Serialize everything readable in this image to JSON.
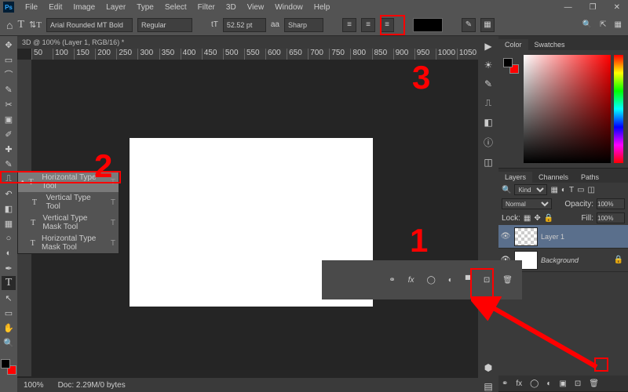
{
  "menu": {
    "items": [
      "File",
      "Edit",
      "Image",
      "Layer",
      "Type",
      "Select",
      "Filter",
      "3D",
      "View",
      "Window",
      "Help"
    ]
  },
  "optbar": {
    "font": "Arial Rounded MT Bold",
    "style": "Regular",
    "size": "52.52 pt",
    "aa": "Sharp",
    "size_prefix": "tT",
    "aa_prefix": "aa"
  },
  "tab": {
    "title": "3D @ 100% (Layer 1, RGB/16) *"
  },
  "ruler": [
    "50",
    "100",
    "150",
    "200",
    "250",
    "300",
    "350",
    "400",
    "450",
    "500",
    "550",
    "600",
    "650",
    "700",
    "750",
    "800",
    "850",
    "900",
    "950",
    "1000",
    "1050"
  ],
  "status": {
    "zoom": "100%",
    "doc": "Doc: 2.29M/0 bytes"
  },
  "flyout": {
    "items": [
      {
        "glyph": "T",
        "label": "Horizontal Type Tool",
        "hot": "T"
      },
      {
        "glyph": "T",
        "label": "Vertical Type Tool",
        "hot": "T"
      },
      {
        "glyph": "T",
        "label": "Vertical Type Mask Tool",
        "hot": "T"
      },
      {
        "glyph": "T",
        "label": "Horizontal Type Mask Tool",
        "hot": "T"
      }
    ]
  },
  "panels": {
    "color": {
      "tabs": [
        "Color",
        "Swatches"
      ]
    },
    "layers": {
      "tabs": [
        "Layers",
        "Channels",
        "Paths"
      ],
      "filter": "Kind",
      "blend": "Normal",
      "opacity_label": "Opacity:",
      "opacity": "100%",
      "lock_label": "Lock:",
      "fill_label": "Fill:",
      "fill": "100%",
      "items": [
        {
          "name": "Layer 1",
          "thumb": "chk",
          "selected": true,
          "eye": "👁"
        },
        {
          "name": "Background",
          "thumb": "white",
          "locked": true,
          "eye": "👁"
        }
      ]
    }
  },
  "annotations": {
    "n1": "1",
    "n2": "2",
    "n3": "3"
  }
}
